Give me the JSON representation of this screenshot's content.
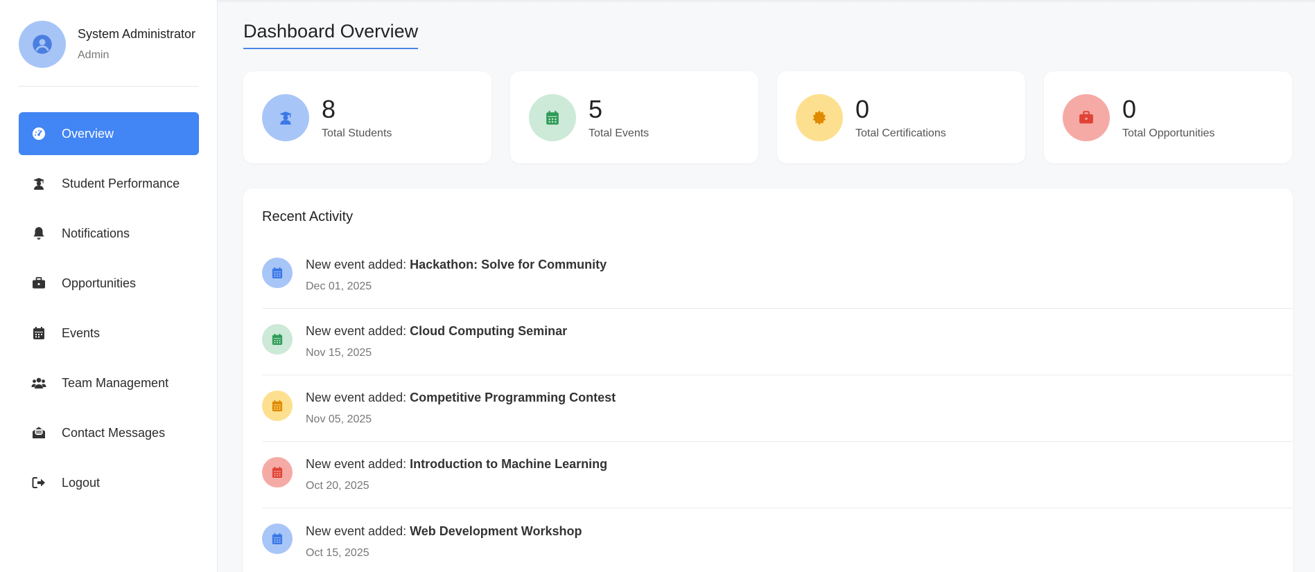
{
  "user": {
    "name": "System Administrator",
    "role": "Admin"
  },
  "nav": [
    {
      "label": "Overview",
      "icon": "gauge-icon",
      "active": true
    },
    {
      "label": "Student Performance",
      "icon": "graduate-icon"
    },
    {
      "label": "Notifications",
      "icon": "bell-icon"
    },
    {
      "label": "Opportunities",
      "icon": "briefcase-icon"
    },
    {
      "label": "Events",
      "icon": "calendar-icon"
    },
    {
      "label": "Team Management",
      "icon": "users-icon"
    },
    {
      "label": "Contact Messages",
      "icon": "envelope-open-icon"
    },
    {
      "label": "Logout",
      "icon": "logout-icon"
    }
  ],
  "page": {
    "title": "Dashboard Overview"
  },
  "stats": [
    {
      "value": "8",
      "label": "Total Students",
      "icon": "graduate-icon",
      "bg": "#a8c5f8",
      "color": "#3b78e7"
    },
    {
      "value": "5",
      "label": "Total Events",
      "icon": "calendar-icon",
      "bg": "#cde9d7",
      "color": "#2e9b57"
    },
    {
      "value": "0",
      "label": "Total Certifications",
      "icon": "certificate-icon",
      "bg": "#fde08f",
      "color": "#e08a00"
    },
    {
      "value": "0",
      "label": "Total Opportunities",
      "icon": "briefcase-icon",
      "bg": "#f6aaa5",
      "color": "#e04437"
    }
  ],
  "activity": {
    "title": "Recent Activity",
    "items": [
      {
        "prefix": "New event added: ",
        "name": "Hackathon: Solve for Community",
        "date": "Dec 01, 2025",
        "bg": "#a8c5f8",
        "color": "#3b78e7"
      },
      {
        "prefix": "New event added: ",
        "name": "Cloud Computing Seminar",
        "date": "Nov 15, 2025",
        "bg": "#cde9d7",
        "color": "#2e9b57"
      },
      {
        "prefix": "New event added: ",
        "name": "Competitive Programming Contest",
        "date": "Nov 05, 2025",
        "bg": "#fde08f",
        "color": "#e08a00"
      },
      {
        "prefix": "New event added: ",
        "name": "Introduction to Machine Learning",
        "date": "Oct 20, 2025",
        "bg": "#f6aaa5",
        "color": "#e04437"
      },
      {
        "prefix": "New event added: ",
        "name": "Web Development Workshop",
        "date": "Oct 15, 2025",
        "bg": "#a8c5f8",
        "color": "#3b78e7"
      }
    ]
  },
  "colors": {
    "accent": "#4285f4"
  }
}
